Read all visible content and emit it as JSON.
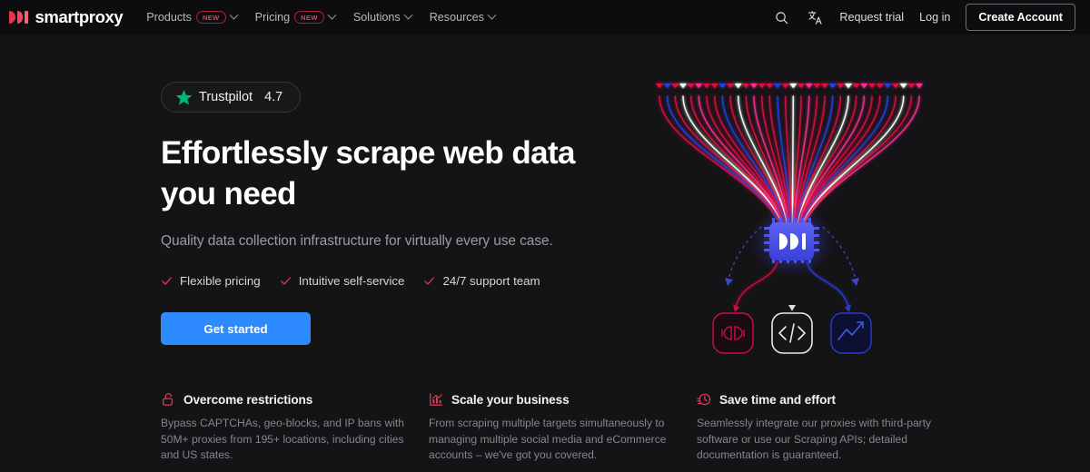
{
  "brand": {
    "name": "smartproxy",
    "accent": "#e8344f",
    "logo_icon": "smartproxy-logo-mark"
  },
  "nav": {
    "links": [
      {
        "label": "Products",
        "badge": "NEW",
        "has_dropdown": true
      },
      {
        "label": "Pricing",
        "badge": "NEW",
        "has_dropdown": true
      },
      {
        "label": "Solutions",
        "badge": "",
        "has_dropdown": true
      },
      {
        "label": "Resources",
        "badge": "",
        "has_dropdown": true
      }
    ],
    "search_icon": "search-icon",
    "language_icon": "translate-icon",
    "request_trial": "Request trial",
    "log_in": "Log in",
    "create_account": "Create Account"
  },
  "hero": {
    "trustpilot": {
      "star_icon": "star-icon",
      "star_color": "#00b67a",
      "label": "Trustpilot",
      "score": "4.7"
    },
    "headline": "Effortlessly scrape web data you need",
    "subheadline": "Quality data collection infrastructure for virtually every use case.",
    "features": [
      {
        "icon": "check-icon",
        "label": "Flexible pricing"
      },
      {
        "icon": "check-icon",
        "label": "Intuitive self-service"
      },
      {
        "icon": "check-icon",
        "label": "24/7 support team"
      }
    ],
    "check_color": "#d6354f",
    "cta": {
      "label": "Get started",
      "color": "#2e8bff"
    }
  },
  "illustration": {
    "name": "proxy-network-diagram",
    "chip_icon": "smartproxy-chip-icon",
    "chip_color": "#4a55e8",
    "nodes": [
      {
        "icon": "plug-icon",
        "color": "#c8103c"
      },
      {
        "icon": "code-brackets-icon",
        "color": "#e8e8ec"
      },
      {
        "icon": "chart-arrow-up-icon",
        "color": "#2a3bd0"
      }
    ],
    "stream_colors": [
      "#e01040",
      "#2840e0",
      "#ff2f8f",
      "#ffffff"
    ]
  },
  "cards": [
    {
      "icon": "unlock-icon",
      "title": "Overcome restrictions",
      "body": "Bypass CAPTCHAs, geo-blocks, and IP bans with 50M+ proxies from 195+ locations, including cities and US states."
    },
    {
      "icon": "bar-chart-icon",
      "title": "Scale your business",
      "body": "From scraping multiple targets simultaneously to managing multiple social media and eCommerce accounts – we've got you covered."
    },
    {
      "icon": "clock-speed-icon",
      "title": "Save time and effort",
      "body": "Seamlessly integrate our proxies with third-party software or use our Scraping APIs; detailed documentation is guaranteed."
    }
  ],
  "card_icon_color": "#e03a55"
}
